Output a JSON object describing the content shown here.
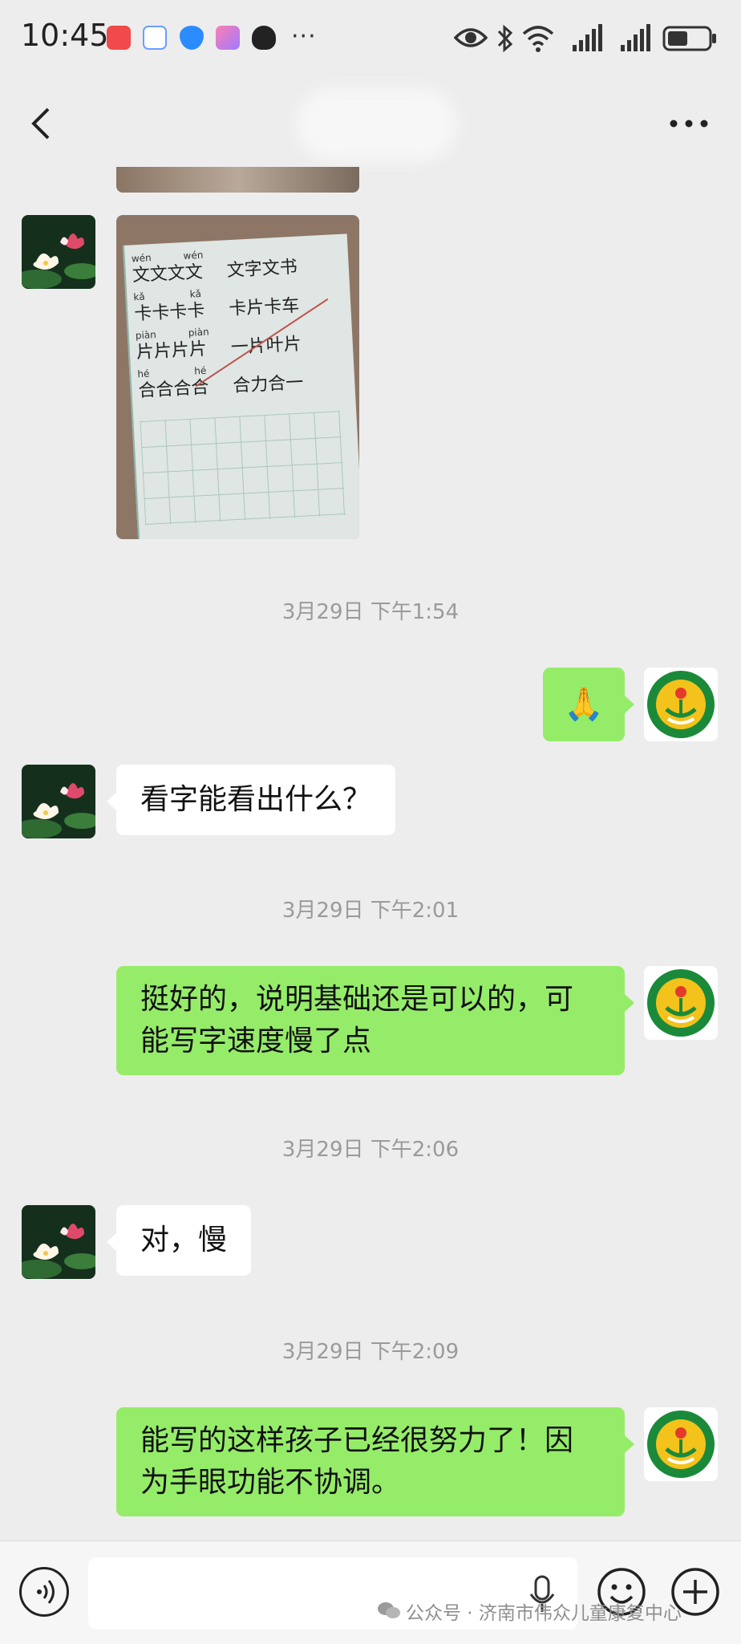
{
  "status_bar": {
    "time": "10:45",
    "more_indicator": "···",
    "notification_icons": [
      "red-app-icon",
      "gaoshou-app-icon",
      "shield-app-icon",
      "pink-app-icon",
      "qq-penguin-icon"
    ],
    "system_icons": [
      "eye-icon",
      "bluetooth-icon",
      "wifi-icon",
      "signal-icon",
      "signal-icon",
      "battery-icon"
    ]
  },
  "title_bar": {
    "back_icon": "back-chevron-icon",
    "more_icon": "more-dots-icon"
  },
  "colors": {
    "background": "#ededed",
    "incoming_bubble": "#ffffff",
    "outgoing_bubble": "#95ec69",
    "timestamp_text": "#9a9a9a"
  },
  "messages": [
    {
      "side": "left",
      "type": "image",
      "description": "handwriting-worksheet-photo-partial"
    },
    {
      "side": "left",
      "type": "image",
      "description": "handwriting-worksheet-photo"
    },
    {
      "type": "timestamp",
      "text": "3月29日 下午1:54"
    },
    {
      "side": "right",
      "type": "emoji",
      "emoji": "🙏"
    },
    {
      "side": "left",
      "type": "text",
      "text": "看字能看出什么？"
    },
    {
      "type": "timestamp",
      "text": "3月29日 下午2:01"
    },
    {
      "side": "right",
      "type": "text",
      "text": "挺好的，说明基础还是可以的，可能写字速度慢了点"
    },
    {
      "type": "timestamp",
      "text": "3月29日 下午2:06"
    },
    {
      "side": "left",
      "type": "text",
      "text": "对，慢"
    },
    {
      "type": "timestamp",
      "text": "3月29日 下午2:09"
    },
    {
      "side": "right",
      "type": "text",
      "text": "能写的这样孩子已经很努力了！因为手眼功能不协调。"
    }
  ],
  "worksheet": {
    "rows": [
      {
        "pinyin": [
          "wén",
          "wén"
        ],
        "left": "文文文文",
        "right": "文字文书"
      },
      {
        "pinyin": [
          "kǎ",
          "kǎ"
        ],
        "left": "卡卡卡卡",
        "right": "卡片卡车"
      },
      {
        "pinyin": [
          "piàn",
          "piàn"
        ],
        "left": "片片片片",
        "right": "一片叶片"
      },
      {
        "pinyin": [
          "hé",
          "hé"
        ],
        "left": "合合合合",
        "right": "合力合一"
      }
    ]
  },
  "input_bar": {
    "voice_icon": "voice-icon",
    "mic_icon": "microphone-icon",
    "emoji_icon": "emoji-icon",
    "plus_icon": "plus-icon"
  },
  "watermark": {
    "icon": "wechat-icon",
    "text": "公众号 · 济南市伟众儿童康复中心"
  }
}
